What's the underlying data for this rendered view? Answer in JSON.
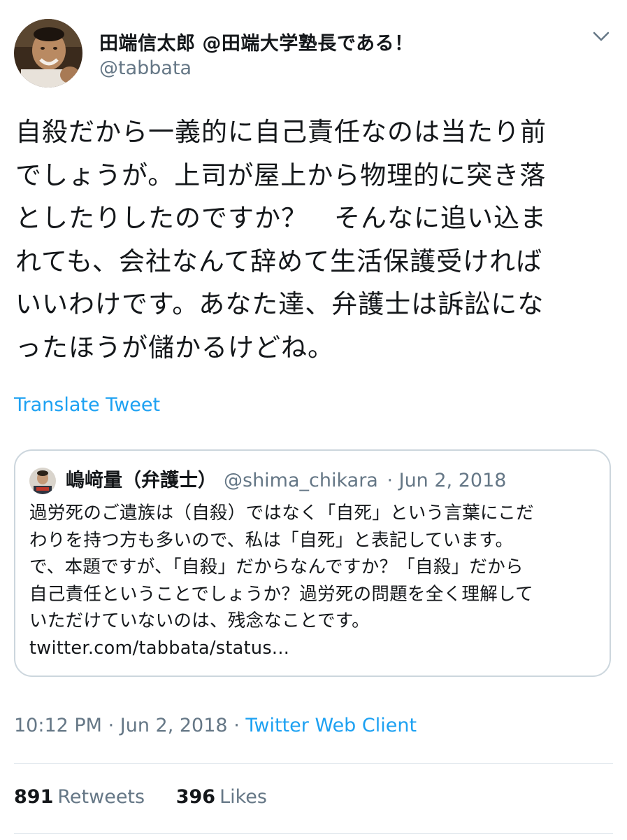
{
  "author": {
    "display_name": "田端信太郎 @田端大学塾長である！",
    "handle": "@tabbata"
  },
  "tweet": {
    "text": "自殺だから一義的に自己責任なのは当たり前\nでしょうが。上司が屋上から物理的に突き落\nとしたりしたのですか？　そんなに追い込ま\nれても、会社なんて辞めて生活保護受ければ\nいいわけです。あなた達、弁護士は訴訟にな\nったほうが儲かるけどね。",
    "translate_label": "Translate Tweet",
    "time": "10:12 PM",
    "date": "Jun 2, 2018",
    "separator": "·",
    "client": "Twitter Web Client"
  },
  "quoted": {
    "display_name": "嶋﨑量（弁護士）",
    "handle": "@shima_chikara",
    "date": "· Jun 2, 2018",
    "text": "過労死のご遺族は（自殺）ではなく「自死」という言葉にこだ\nわりを持つ方も多いので、私は「自死」と表記しています。\nで、本題ですが、「自殺」だからなんですか？「自殺」だから\n自己責任ということでしょうか？過労死の問題を全く理解して\nいただけていないのは、残念なことです。\ntwitter.com/tabbata/status..."
  },
  "stats": {
    "retweets_count": "891",
    "retweets_label": "Retweets",
    "likes_count": "396",
    "likes_label": "Likes"
  },
  "colors": {
    "link": "#1da1f2",
    "secondary_text": "#657786",
    "border": "#ccd6dd",
    "divider": "#e1e8ed"
  },
  "icons": {
    "caret": "chevron-down-icon"
  }
}
